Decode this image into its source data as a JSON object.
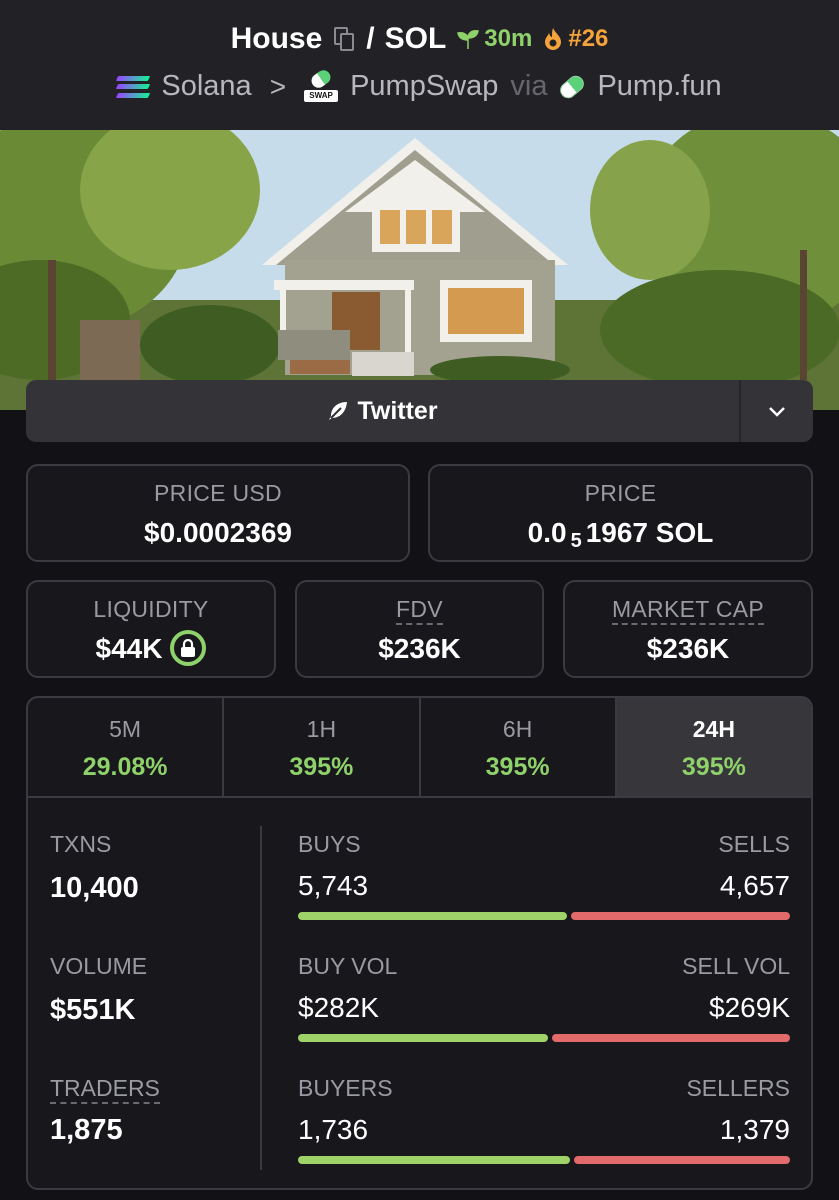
{
  "header": {
    "token_name": "House",
    "separator": "/",
    "quote": "SOL",
    "age": "30m",
    "rank": "#26",
    "chain": "Solana",
    "dex": "PumpSwap",
    "via": "via",
    "launchpad": "Pump.fun",
    "swap_tag": "SWAP"
  },
  "socials": {
    "twitter_label": "Twitter"
  },
  "price_usd": {
    "label": "PRICE USD",
    "value": "$0.0002369"
  },
  "price": {
    "label": "PRICE",
    "prefix": "0.0",
    "sub": "5",
    "suffix": "1967 SOL"
  },
  "liquidity": {
    "label": "LIQUIDITY",
    "value": "$44K"
  },
  "fdv": {
    "label": "FDV",
    "value": "$236K"
  },
  "market_cap": {
    "label": "MARKET CAP",
    "value": "$236K"
  },
  "tabs": [
    {
      "label": "5M",
      "value": "29.08%"
    },
    {
      "label": "1H",
      "value": "395%"
    },
    {
      "label": "6H",
      "value": "395%"
    },
    {
      "label": "24H",
      "value": "395%"
    }
  ],
  "txns": {
    "label": "TXNS",
    "value": "10,400"
  },
  "volume": {
    "label": "VOLUME",
    "value": "$551K"
  },
  "traders": {
    "label": "TRADERS",
    "value": "1,875"
  },
  "buys_sells": {
    "left_label": "BUYS",
    "right_label": "SELLS",
    "left_value": "5,743",
    "right_value": "4,657",
    "left_fraction": 0.552
  },
  "buy_sell_vol": {
    "left_label": "BUY VOL",
    "right_label": "SELL VOL",
    "left_value": "$282K",
    "right_value": "$269K",
    "left_fraction": 0.512
  },
  "buyers_sellers": {
    "left_label": "BUYERS",
    "right_label": "SELLERS",
    "left_value": "1,736",
    "right_value": "1,379",
    "left_fraction": 0.557
  },
  "colors": {
    "positive": "#8fd16a",
    "buy_bar": "#9fd36a",
    "sell_bar": "#e26a6a",
    "rank": "#f7a33b"
  }
}
